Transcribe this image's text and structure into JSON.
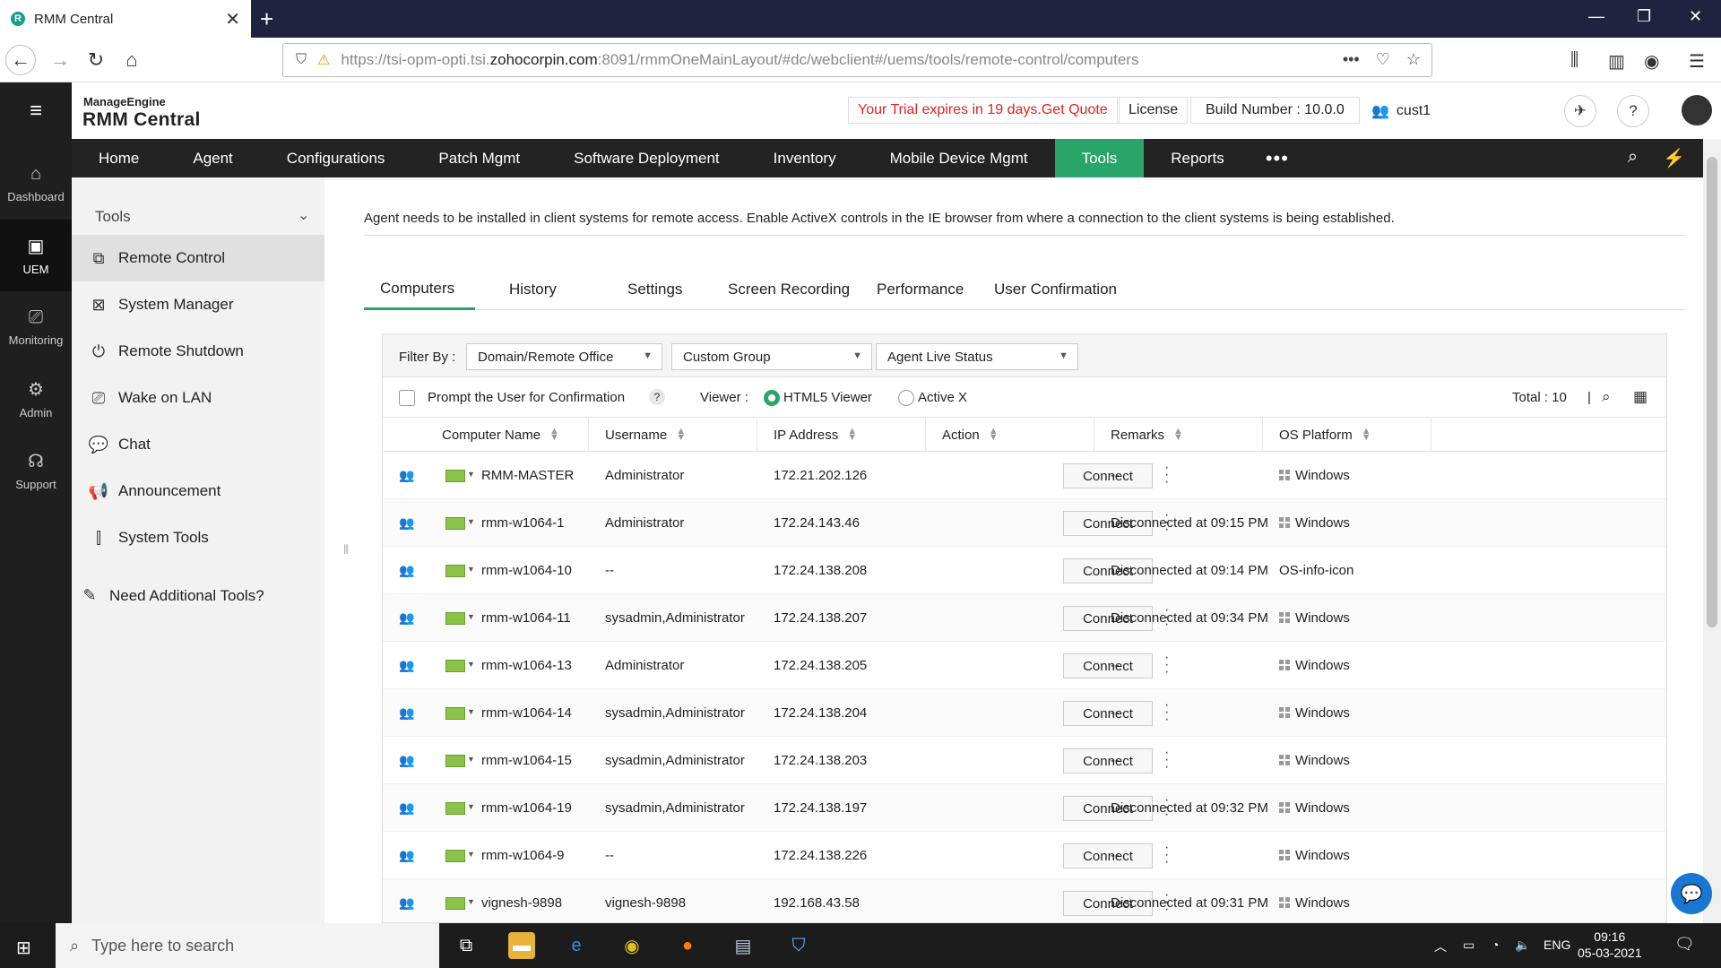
{
  "browser": {
    "tab_title": "RMM Central",
    "url_prefix": "https://tsi-opm-opti.tsi.",
    "url_domain": "zohocorpin.com",
    "url_suffix": ":8091/rmmOneMainLayout/#dc/webclient#/uems/tools/remote-control/computers"
  },
  "header": {
    "brand_top": "ManageEngine",
    "brand_product": "RMM Central",
    "trial_text": "Your Trial expires in 19 days.",
    "trial_link": "Get Quote",
    "license": "License",
    "build": "Build Number : 10.0.0",
    "user": "cust1"
  },
  "rail": [
    {
      "label": "Dashboard"
    },
    {
      "label": "UEM"
    },
    {
      "label": "Monitoring"
    },
    {
      "label": "Admin"
    },
    {
      "label": "Support"
    }
  ],
  "mainnav": [
    "Home",
    "Agent",
    "Configurations",
    "Patch Mgmt",
    "Software Deployment",
    "Inventory",
    "Mobile Device Mgmt",
    "Tools",
    "Reports"
  ],
  "tools_panel": {
    "heading": "Tools",
    "items": [
      "Remote Control",
      "System Manager",
      "Remote Shutdown",
      "Wake on LAN",
      "Chat",
      "Announcement",
      "System Tools"
    ],
    "extra": "Need Additional Tools?"
  },
  "info_text": "Agent needs to be installed in client systems for remote access. Enable ActiveX controls in the IE browser from where a connection to the client systems is being established.",
  "subtabs": [
    "Computers",
    "History",
    "Settings",
    "Screen Recording",
    "Performance",
    "User Confirmation"
  ],
  "filters": {
    "label": "Filter By :",
    "domain": "Domain/Remote Office",
    "group": "Custom Group",
    "status": "Agent Live Status"
  },
  "options": {
    "prompt": "Prompt the User for Confirmation",
    "help": "?",
    "viewer_label": "Viewer :",
    "html5": "HTML5 Viewer",
    "activex": "Active X",
    "total": "Total : 10",
    "separator": "|"
  },
  "columns": [
    "Computer Name",
    "Username",
    "IP Address",
    "Action",
    "Remarks",
    "OS Platform"
  ],
  "connect_label": "Connect",
  "rows": [
    {
      "name": "RMM-MASTER",
      "user": "Administrator",
      "ip": "172.21.202.126",
      "remarks": "--",
      "os": "Windows",
      "menu": true
    },
    {
      "name": "rmm-w1064-1",
      "user": "Administrator",
      "ip": "172.24.143.46",
      "remarks": "Disconnected at 09:15 PM",
      "os": "Windows",
      "menu": true
    },
    {
      "name": "rmm-w1064-10",
      "user": "--",
      "ip": "172.24.138.208",
      "remarks": "Disconnected at 09:14 PM",
      "os": "OS-info-icon",
      "menu": false
    },
    {
      "name": "rmm-w1064-11",
      "user": "sysadmin,Administrator",
      "ip": "172.24.138.207",
      "remarks": "Disconnected at 09:34 PM",
      "os": "Windows",
      "menu": true
    },
    {
      "name": "rmm-w1064-13",
      "user": "Administrator",
      "ip": "172.24.138.205",
      "remarks": "--",
      "os": "Windows",
      "menu": true
    },
    {
      "name": "rmm-w1064-14",
      "user": "sysadmin,Administrator",
      "ip": "172.24.138.204",
      "remarks": "--",
      "os": "Windows",
      "menu": true
    },
    {
      "name": "rmm-w1064-15",
      "user": "sysadmin,Administrator",
      "ip": "172.24.138.203",
      "remarks": "--",
      "os": "Windows",
      "menu": true
    },
    {
      "name": "rmm-w1064-19",
      "user": "sysadmin,Administrator",
      "ip": "172.24.138.197",
      "remarks": "Disconnected at 09:32 PM",
      "os": "Windows",
      "menu": true
    },
    {
      "name": "rmm-w1064-9",
      "user": "--",
      "ip": "172.24.138.226",
      "remarks": "--",
      "os": "Windows",
      "menu": true
    },
    {
      "name": "vignesh-9898",
      "user": "vignesh-9898",
      "ip": "192.168.43.58",
      "remarks": "Disconnected at 09:31 PM",
      "os": "Windows",
      "menu": true
    }
  ],
  "taskbar": {
    "search_placeholder": "Type here to search",
    "lang": "ENG",
    "time": "09:16",
    "date": "05-03-2021"
  },
  "colors": {
    "accent": "#2aa56a",
    "nav_bg": "#232323",
    "rail_bg": "#1f1f1f",
    "trial_red": "#e0241b",
    "monitor_green": "#8bc34a"
  }
}
